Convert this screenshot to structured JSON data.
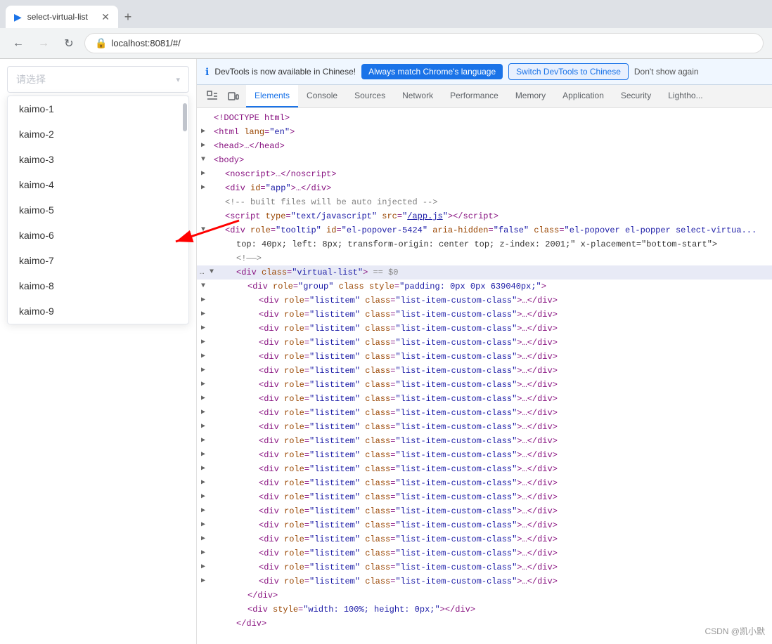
{
  "browser": {
    "tab_title": "select-virtual-list",
    "url": "localhost:8081/#/",
    "new_tab_icon": "+"
  },
  "devtools_banner": {
    "message": "DevTools is now available in Chinese!",
    "btn_language": "Always match Chrome's language",
    "btn_switch": "Switch DevTools to Chinese",
    "btn_dismiss": "Don't show again"
  },
  "devtools_tabs": [
    {
      "label": "Elements",
      "active": true
    },
    {
      "label": "Console",
      "active": false
    },
    {
      "label": "Sources",
      "active": false
    },
    {
      "label": "Network",
      "active": false
    },
    {
      "label": "Performance",
      "active": false
    },
    {
      "label": "Memory",
      "active": false
    },
    {
      "label": "Application",
      "active": false
    },
    {
      "label": "Security",
      "active": false
    },
    {
      "label": "Lightho...",
      "active": false
    }
  ],
  "select": {
    "placeholder": "请选择",
    "items": [
      "kaimo-1",
      "kaimo-2",
      "kaimo-3",
      "kaimo-4",
      "kaimo-5",
      "kaimo-6",
      "kaimo-7",
      "kaimo-8",
      "kaimo-9"
    ]
  },
  "code_lines": [
    {
      "text": "<!DOCTYPE html>",
      "indent": 0,
      "type": "doctype"
    },
    {
      "text": "<html lang=\"en\">",
      "indent": 0,
      "type": "tag",
      "expandable": true
    },
    {
      "text": "▶ <head>…</head>",
      "indent": 1,
      "type": "collapsed"
    },
    {
      "text": "▼ <body>",
      "indent": 1,
      "type": "open",
      "expandable": true
    },
    {
      "text": "▶ <noscript>…</noscript>",
      "indent": 2,
      "type": "collapsed"
    },
    {
      "text": "▶ <div id=\"app\">…</div>",
      "indent": 2,
      "type": "collapsed"
    },
    {
      "text": "<!-- built files will be auto injected -->",
      "indent": 2,
      "type": "comment"
    },
    {
      "text": "<script type=\"text/javascript\" src=\"/app.js\"><\\/script>",
      "indent": 2,
      "type": "tag"
    },
    {
      "text": "▼ <div role=\"tooltip\" id=\"el-popover-5424\" aria-hidden=\"false\" class=\"el-popover el-popper select-virtua...",
      "indent": 2,
      "type": "open"
    },
    {
      "text": "top: 40px; left: 8px; transform-origin: center top; z-index: 2001;\" x-placement=\"bottom-start\">",
      "indent": 3,
      "type": "text"
    },
    {
      "text": "<!——>",
      "indent": 3,
      "type": "comment"
    },
    {
      "text": "▼ <div class=\"virtual-list\"> == $0",
      "indent": 3,
      "type": "open",
      "selected": true,
      "dots": true
    },
    {
      "text": "▼ <div role=\"group\" class style=\"padding: 0px 0px 639040px;\">",
      "indent": 4,
      "type": "open"
    },
    {
      "text": "▶ <div role=\"listitem\" class=\"list-item-custom-class\">…</div>",
      "indent": 5,
      "type": "collapsed"
    },
    {
      "text": "▶ <div role=\"listitem\" class=\"list-item-custom-class\">…</div>",
      "indent": 5,
      "type": "collapsed"
    },
    {
      "text": "▶ <div role=\"listitem\" class=\"list-item-custom-class\">…</div>",
      "indent": 5,
      "type": "collapsed"
    },
    {
      "text": "▶ <div role=\"listitem\" class=\"list-item-custom-class\">…</div>",
      "indent": 5,
      "type": "collapsed"
    },
    {
      "text": "▶ <div role=\"listitem\" class=\"list-item-custom-class\">…</div>",
      "indent": 5,
      "type": "collapsed"
    },
    {
      "text": "▶ <div role=\"listitem\" class=\"list-item-custom-class\">…</div>",
      "indent": 5,
      "type": "collapsed"
    },
    {
      "text": "▶ <div role=\"listitem\" class=\"list-item-custom-class\">…</div>",
      "indent": 5,
      "type": "collapsed"
    },
    {
      "text": "▶ <div role=\"listitem\" class=\"list-item-custom-class\">…</div>",
      "indent": 5,
      "type": "collapsed"
    },
    {
      "text": "▶ <div role=\"listitem\" class=\"list-item-custom-class\">…</div>",
      "indent": 5,
      "type": "collapsed"
    },
    {
      "text": "▶ <div role=\"listitem\" class=\"list-item-custom-class\">…</div>",
      "indent": 5,
      "type": "collapsed"
    },
    {
      "text": "▶ <div role=\"listitem\" class=\"list-item-custom-class\">…</div>",
      "indent": 5,
      "type": "collapsed"
    },
    {
      "text": "▶ <div role=\"listitem\" class=\"list-item-custom-class\">…</div>",
      "indent": 5,
      "type": "collapsed"
    },
    {
      "text": "▶ <div role=\"listitem\" class=\"list-item-custom-class\">…</div>",
      "indent": 5,
      "type": "collapsed"
    },
    {
      "text": "▶ <div role=\"listitem\" class=\"list-item-custom-class\">…</div>",
      "indent": 5,
      "type": "collapsed"
    },
    {
      "text": "▶ <div role=\"listitem\" class=\"list-item-custom-class\">…</div>",
      "indent": 5,
      "type": "collapsed"
    },
    {
      "text": "▶ <div role=\"listitem\" class=\"list-item-custom-class\">…</div>",
      "indent": 5,
      "type": "collapsed"
    },
    {
      "text": "▶ <div role=\"listitem\" class=\"list-item-custom-class\">…</div>",
      "indent": 5,
      "type": "collapsed"
    },
    {
      "text": "▶ <div role=\"listitem\" class=\"list-item-custom-class\">…</div>",
      "indent": 5,
      "type": "collapsed"
    },
    {
      "text": "▶ <div role=\"listitem\" class=\"list-item-custom-class\">…</div>",
      "indent": 5,
      "type": "collapsed"
    },
    {
      "text": "▶ <div role=\"listitem\" class=\"list-item-custom-class\">…</div>",
      "indent": 5,
      "type": "collapsed"
    },
    {
      "text": "▶ <div role=\"listitem\" class=\"list-item-custom-class\">…</div>",
      "indent": 5,
      "type": "collapsed"
    },
    {
      "text": "▶ <div role=\"listitem\" class=\"list-item-custom-class\">…</div>",
      "indent": 5,
      "type": "collapsed"
    },
    {
      "text": "</div>",
      "indent": 4,
      "type": "close"
    },
    {
      "text": "<div style=\"width: 100%; height: 0px;\"></div>",
      "indent": 4,
      "type": "tag"
    },
    {
      "text": "</div>",
      "indent": 3,
      "type": "close"
    }
  ],
  "watermark": "CSDN @凯小默"
}
